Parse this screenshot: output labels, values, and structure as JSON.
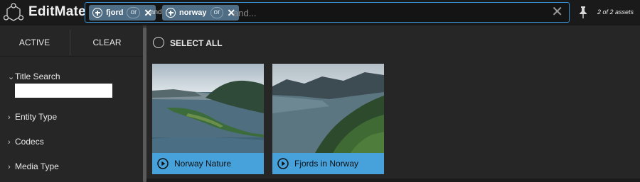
{
  "app": {
    "name": "EditMate"
  },
  "search": {
    "chips": [
      {
        "term": "fjord",
        "operator": "or"
      },
      {
        "term": "norway",
        "operator": "or"
      }
    ],
    "joiner": "and",
    "placeholder": "and...",
    "value": ""
  },
  "header": {
    "asset_count": "2 of 2 assets"
  },
  "sidebar": {
    "tabs": [
      {
        "label": "ACTIVE"
      },
      {
        "label": "CLEAR"
      }
    ],
    "filters": [
      {
        "label": "Title Search",
        "expanded": true
      },
      {
        "label": "Entity Type",
        "expanded": false
      },
      {
        "label": "Codecs",
        "expanded": false
      },
      {
        "label": "Media Type",
        "expanded": false
      }
    ]
  },
  "main": {
    "select_all_label": "SELECT ALL",
    "cards": [
      {
        "title": "Norway Nature"
      },
      {
        "title": "Fjords in Norway"
      }
    ]
  },
  "colors": {
    "accent": "#47a2dc",
    "search_border": "#3a8fd0",
    "chip_bg": "#4f6e85",
    "background": "#262626",
    "topbar": "#1a1a1a"
  },
  "icons": {
    "logo": "editmate-logo-icon",
    "chip_add": "plus-circle-icon",
    "chip_remove": "close-icon",
    "search_clear": "close-icon",
    "pin": "pin-icon",
    "card_play": "play-circle-icon",
    "filter_chevron": "chevron-icon"
  }
}
